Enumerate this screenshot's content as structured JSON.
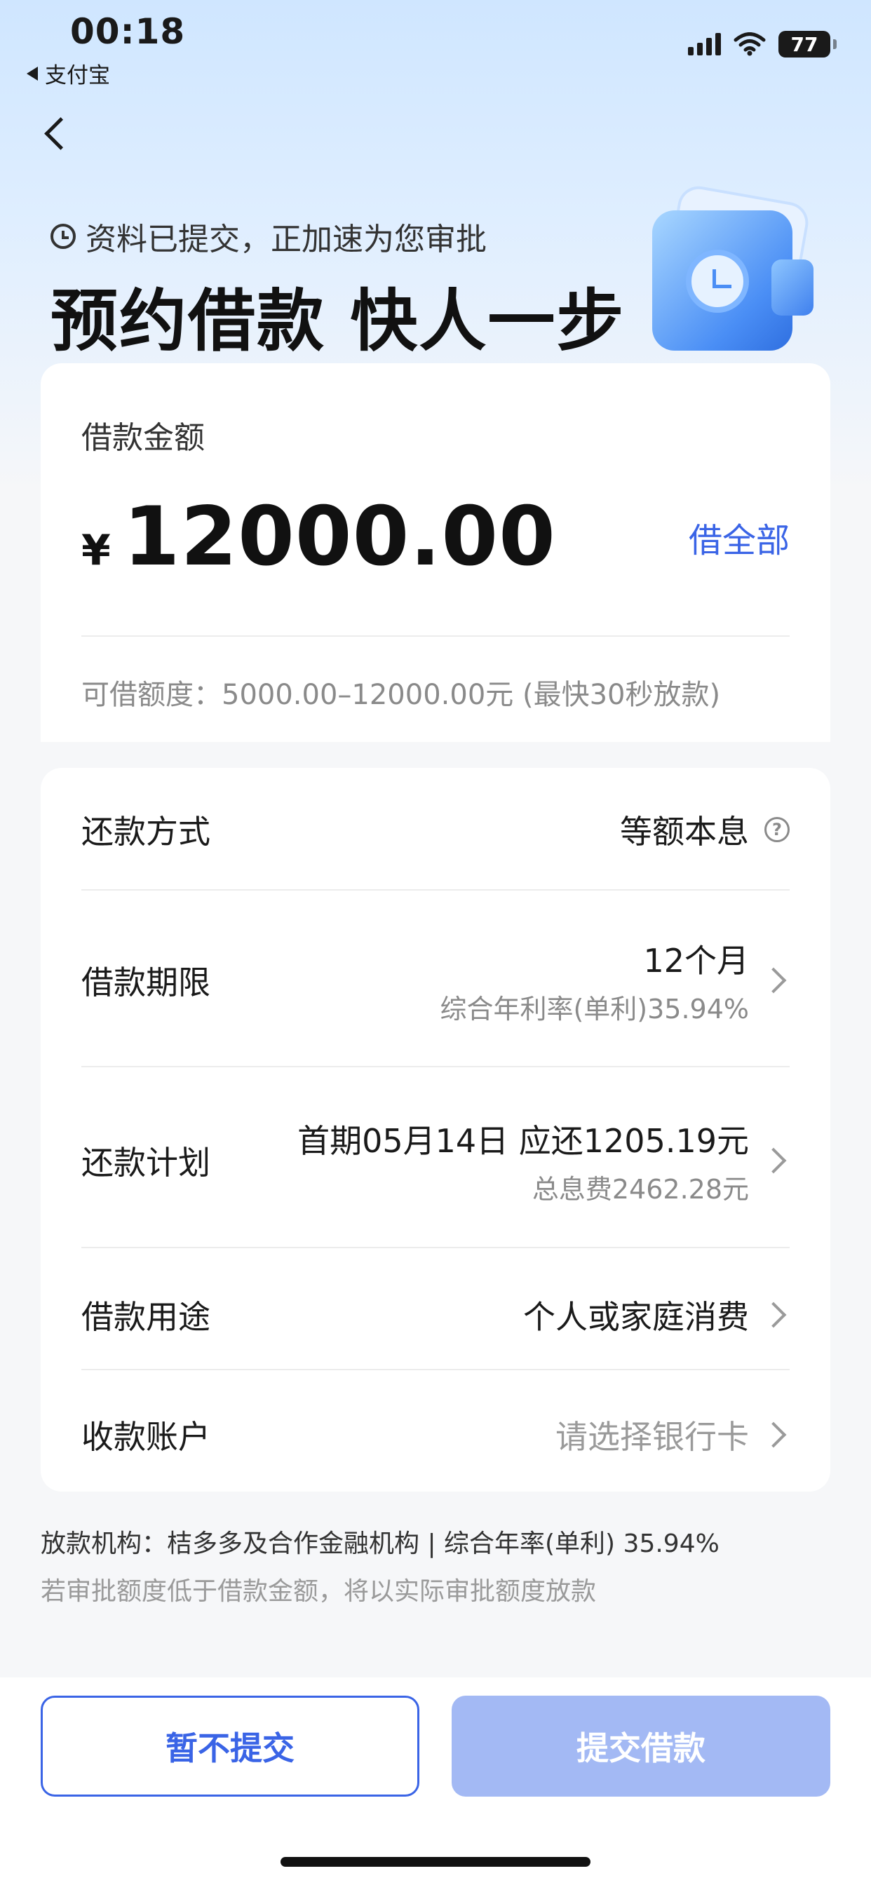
{
  "status_bar": {
    "time": "00:18",
    "back_app": "支付宝",
    "battery": "77"
  },
  "header": {
    "status_text": "资料已提交，正加速为您审批",
    "headline": "预约借款 快人一步"
  },
  "amount_card": {
    "label": "借款金额",
    "currency": "¥",
    "amount": "12000.00",
    "borrow_all": "借全部",
    "range": "可借额度：5000.00–12000.00元 (最快30秒放款)"
  },
  "details": {
    "repayment_method": {
      "label": "还款方式",
      "value": "等额本息"
    },
    "term": {
      "label": "借款期限",
      "value": "12个月",
      "sub": "综合年利率(单利)35.94%"
    },
    "plan": {
      "label": "还款计划",
      "value": "首期05月14日 应还1205.19元",
      "sub": "总息费2462.28元"
    },
    "purpose": {
      "label": "借款用途",
      "value": "个人或家庭消费"
    },
    "account": {
      "label": "收款账户",
      "placeholder": "请选择银行卡"
    }
  },
  "footnotes": {
    "lender": "放款机构：桔多多及合作金融机构 | 综合年率(单利) 35.94%",
    "notice": "若审批额度低于借款金额，将以实际审批额度放款"
  },
  "buttons": {
    "cancel": "暂不提交",
    "submit": "提交借款"
  },
  "colors": {
    "accent": "#3a64e6",
    "submit_disabled": "#a3b9f4"
  }
}
